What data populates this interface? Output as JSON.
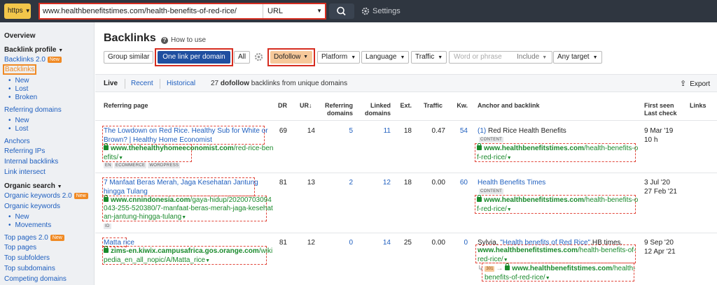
{
  "topbar": {
    "protocol": "https",
    "url": "www.healthbenefitstimes.com/health-benefits-of-red-rice/",
    "mode": "URL",
    "settings_label": "Settings"
  },
  "sidebar": {
    "overview": "Overview",
    "backlink_profile": "Backlink profile",
    "backlinks_20": "Backlinks 2.0",
    "new_badge": "New",
    "backlinks": "Backlinks",
    "backlinks_sub": [
      "New",
      "Lost",
      "Broken"
    ],
    "referring_domains": "Referring domains",
    "referring_domains_sub": [
      "New",
      "Lost"
    ],
    "anchors": "Anchors",
    "referring_ips": "Referring IPs",
    "internal_backlinks": "Internal backlinks",
    "link_intersect": "Link intersect",
    "organic_search": "Organic search",
    "organic_keywords_20": "Organic keywords 2.0",
    "organic_keywords": "Organic keywords",
    "organic_keywords_sub": [
      "New",
      "Movements"
    ],
    "top_pages_20": "Top pages 2.0",
    "top_pages": "Top pages",
    "top_subfolders": "Top subfolders",
    "top_subdomains": "Top subdomains",
    "competing_domains": "Competing domains"
  },
  "main": {
    "title": "Backlinks",
    "how_to": "How to use",
    "filters": {
      "group_similar": "Group similar",
      "one_link": "One link per domain",
      "all": "All",
      "dofollow": "Dofollow",
      "platform": "Platform",
      "language": "Language",
      "traffic": "Traffic",
      "word_placeholder": "Word or phrase",
      "include": "Include",
      "any_target": "Any target"
    },
    "tabs": {
      "live": "Live",
      "recent": "Recent",
      "historical": "Historical"
    },
    "summary_count": "27",
    "summary_bold": "dofollow",
    "summary_rest": "backlinks from unique domains",
    "export": "Export"
  },
  "table": {
    "headers": {
      "referring_page": "Referring page",
      "dr": "DR",
      "ur": "UR",
      "referring_domains": [
        "Referring",
        "domains"
      ],
      "linked_domains": [
        "Linked",
        "domains"
      ],
      "ext": "Ext.",
      "traffic": "Traffic",
      "kw": "Kw.",
      "anchor": "Anchor and backlink",
      "first_seen": [
        "First seen",
        "Last check"
      ],
      "links": "Links"
    },
    "rows": [
      {
        "title": [
          "The Lowdown on Red Rice. Healthy Sub for White or",
          "Brown? | Healthy Home Economist"
        ],
        "url_bold": "www.thehealthyhomeeconomist.com",
        "url_rest": [
          "/red-rice-ben",
          "efits/"
        ],
        "tags": [
          "EN",
          "ECOMMERCE",
          "WORDPRESS"
        ],
        "dr": "69",
        "ur": "14",
        "ref_domains": "5",
        "linked_domains": "11",
        "ext": "18",
        "traffic": "0.47",
        "kw": "54",
        "anchor_prefix": "(1)",
        "anchor_text": "Red Rice Health Benefits",
        "anchor_tag": "CONTENT",
        "backlink_bold": "www.healthbenefitstimes.com",
        "backlink_rest": [
          "/health-benefits-o",
          "f-red-rice/"
        ],
        "first_seen": "9 Mar '19",
        "last_check": "10 h"
      },
      {
        "title": [
          "7 Manfaat Beras Merah, Jaga Kesehatan Jantung",
          "hingga Tulang"
        ],
        "url_bold": "www.cnnindonesia.com",
        "url_rest": [
          "/gaya-hidup/20200703094",
          "043-255-520380/7-manfaat-beras-merah-jaga-kesehat",
          "an-jantung-hingga-tulang"
        ],
        "tags": [
          "ID"
        ],
        "dr": "81",
        "ur": "13",
        "ref_domains": "2",
        "linked_domains": "12",
        "ext": "18",
        "traffic": "0.00",
        "kw": "60",
        "anchor_text": "Health Benefits Times",
        "anchor_tag": "CONTENT",
        "backlink_bold": "www.healthbenefitstimes.com",
        "backlink_rest": [
          "/health-benefits-o",
          "f-red-rice/"
        ],
        "first_seen": "3 Jul '20",
        "last_check": "27 Feb '21"
      },
      {
        "title": [
          "Matta rice"
        ],
        "url_bold": "zims-en.kiwix.campusafrica.gos.orange.com",
        "url_rest": [
          "/wiki",
          "pedia_en_all_nopic/A/Matta_rice"
        ],
        "dr": "81",
        "ur": "12",
        "ref_domains": "0",
        "linked_domains": "14",
        "ext": "25",
        "traffic": "0.00",
        "kw": "0",
        "anchor_plain_1": "Sylvia.",
        "anchor_link": "\"Health benefits of Red Rice\"",
        "anchor_plain_2": ".HB times.",
        "backlink_bold": "www.healthbenefitstimes.com",
        "backlink_rest": [
          "/health-benefits-of-",
          "red-rice/"
        ],
        "redirect_code": "301",
        "redirect_bold": "www.healthbenefitstimes.com",
        "redirect_rest": [
          "/health-",
          "benefits-of-red-rice/"
        ],
        "first_seen": "9 Sep '20",
        "last_check": "12 Apr '21"
      }
    ]
  }
}
